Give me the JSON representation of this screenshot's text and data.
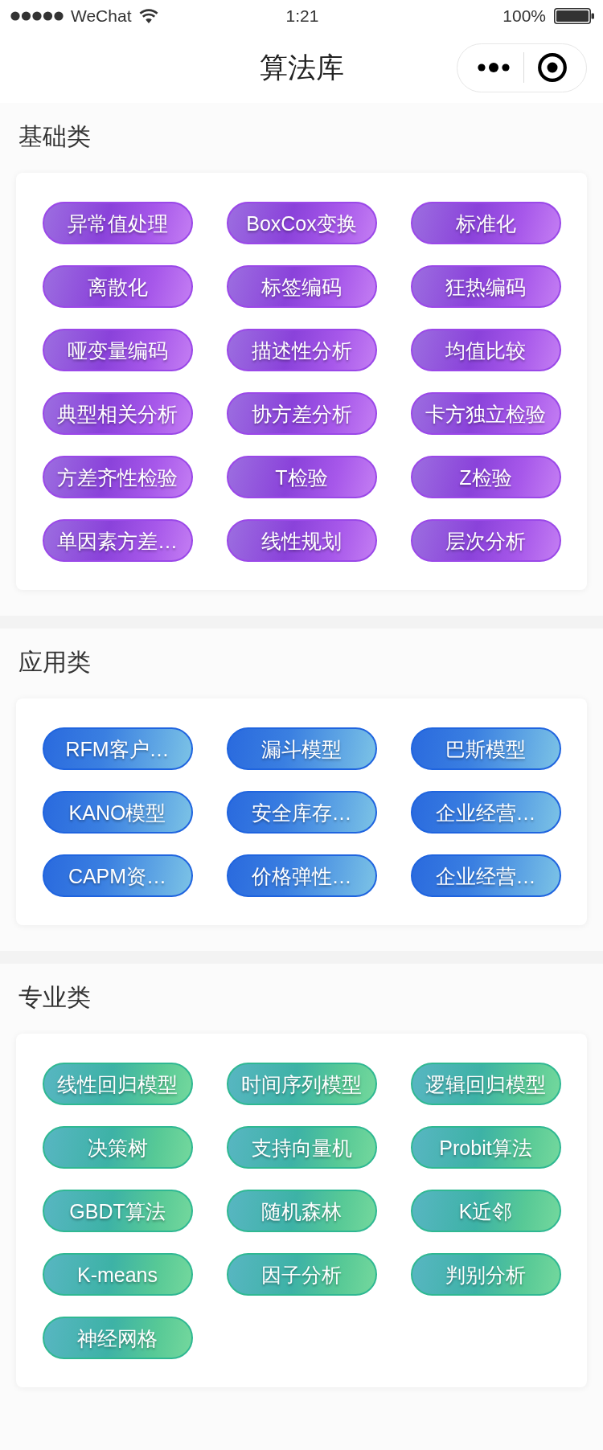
{
  "status_bar": {
    "carrier": "WeChat",
    "time": "1:21",
    "battery": "100%"
  },
  "nav_bar": {
    "title": "算法库"
  },
  "sections": [
    {
      "title": "基础类",
      "kind": "basic",
      "items": [
        "异常值处理",
        "BoxCox变换",
        "标准化",
        "离散化",
        "标签编码",
        "狂热编码",
        "哑变量编码",
        "描述性分析",
        "均值比较",
        "典型相关分析",
        "协方差分析",
        "卡方独立检验",
        "方差齐性检验",
        "T检验",
        "Z检验",
        "单因素方差…",
        "线性规划",
        "层次分析"
      ]
    },
    {
      "title": "应用类",
      "kind": "applied",
      "items": [
        "RFM客户…",
        "漏斗模型",
        "巴斯模型",
        "KANO模型",
        "安全库存…",
        "企业经营…",
        "CAPM资…",
        "价格弹性…",
        "企业经营…"
      ]
    },
    {
      "title": "专业类",
      "kind": "professional",
      "items": [
        "线性回归模型",
        "时间序列模型",
        "逻辑回归模型",
        "决策树",
        "支持向量机",
        "Probit算法",
        "GBDT算法",
        "随机森林",
        "K近邻",
        "K-means",
        "因子分析",
        "判别分析",
        "神经网格"
      ]
    }
  ]
}
